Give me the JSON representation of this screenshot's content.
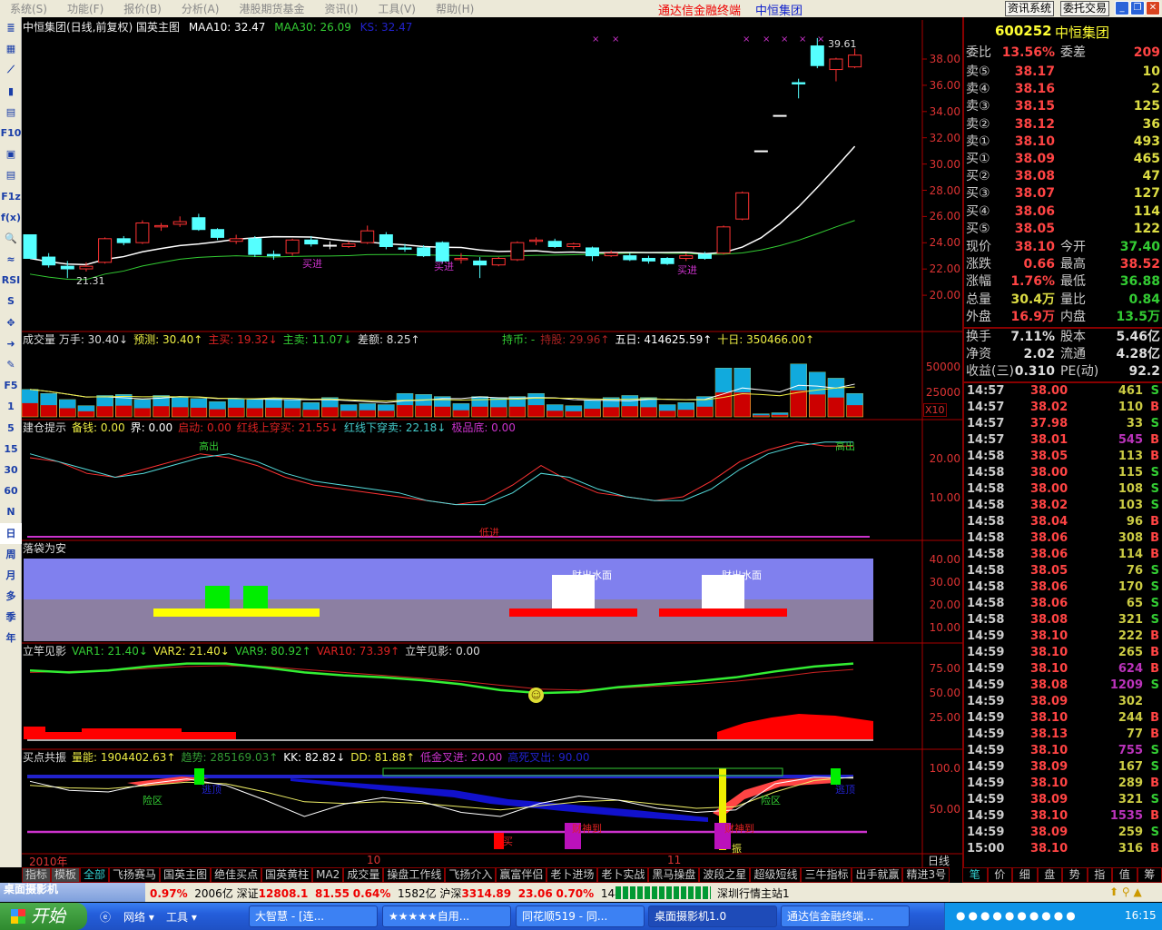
{
  "menu": [
    "系统(S)",
    "功能(F)",
    "报价(B)",
    "分析(A)",
    "港股期货基金",
    "资讯(I)",
    "工具(V)",
    "帮助(H)"
  ],
  "app_title": "通达信金融终端",
  "app_stock": "中恒集团",
  "top_buttons": {
    "news": "资讯系统",
    "trade": "委托交易"
  },
  "left_toolbar": [
    "≣",
    "▦",
    "⟋",
    "▮",
    "▤",
    "F10",
    "▣",
    "▤",
    "F1z",
    "f(x)",
    "🔍",
    "≈",
    "RSI",
    "S",
    "✥",
    "➜",
    "✎",
    "F5",
    "1",
    "5",
    "15",
    "30",
    "60",
    "N",
    "日",
    "周",
    "月",
    "多",
    "季",
    "年"
  ],
  "main_panel": {
    "title": "中恒集团(日线,前复权) 国英主图",
    "maa10": "MAA10: 32.47",
    "maa30": "MAA30: 26.09",
    "ks": "KS: 32.47",
    "high_label": "39.61",
    "low_label": "21.31",
    "buy_labels": [
      "买进",
      "买进",
      "买进"
    ],
    "axis": [
      "38.00",
      "36.00",
      "34.00",
      "32.00",
      "30.00",
      "28.00",
      "26.00",
      "24.00",
      "22.00",
      "20.00"
    ],
    "candles": [
      [
        24.6,
        24.6,
        22.8,
        22.8
      ],
      [
        22.9,
        23.2,
        22.1,
        22.3
      ],
      [
        22.2,
        22.6,
        21.3,
        22.0
      ],
      [
        22.0,
        22.5,
        21.8,
        22.2
      ],
      [
        22.5,
        24.4,
        22.4,
        24.3
      ],
      [
        24.3,
        24.5,
        23.8,
        24.0
      ],
      [
        24.0,
        25.7,
        23.9,
        25.5
      ],
      [
        25.2,
        25.5,
        24.9,
        25.3
      ],
      [
        25.4,
        26.0,
        25.2,
        25.6
      ],
      [
        25.9,
        26.2,
        24.9,
        25.0
      ],
      [
        25.0,
        25.1,
        24.2,
        24.4
      ],
      [
        24.1,
        24.6,
        23.9,
        24.3
      ],
      [
        24.3,
        24.5,
        22.9,
        23.1
      ],
      [
        23.1,
        23.4,
        22.7,
        23.0
      ],
      [
        23.2,
        24.3,
        23.0,
        24.2
      ],
      [
        24.2,
        24.5,
        23.7,
        23.9
      ],
      [
        23.8,
        24.1,
        23.5,
        23.8
      ],
      [
        23.7,
        24.1,
        23.6,
        23.9
      ],
      [
        24.0,
        25.3,
        23.9,
        24.9
      ],
      [
        24.6,
        24.8,
        23.5,
        23.7
      ],
      [
        23.6,
        23.9,
        23.3,
        23.5
      ],
      [
        23.6,
        23.8,
        22.9,
        23.0
      ],
      [
        24.0,
        24.1,
        22.4,
        22.6
      ],
      [
        22.7,
        23.2,
        22.4,
        22.8
      ],
      [
        22.6,
        22.9,
        21.3,
        22.3
      ],
      [
        22.3,
        22.9,
        22.2,
        22.8
      ],
      [
        22.7,
        24.1,
        22.6,
        24.0
      ],
      [
        24.1,
        24.4,
        23.8,
        24.2
      ],
      [
        24.1,
        24.3,
        23.6,
        23.7
      ],
      [
        23.7,
        24.0,
        23.5,
        23.9
      ],
      [
        23.6,
        23.7,
        22.6,
        23.0
      ],
      [
        23.0,
        23.4,
        22.9,
        23.2
      ],
      [
        23.0,
        23.2,
        22.6,
        22.7
      ],
      [
        22.8,
        23.0,
        22.4,
        22.6
      ],
      [
        22.8,
        22.9,
        22.3,
        22.4
      ],
      [
        22.8,
        23.2,
        22.6,
        23.0
      ],
      [
        23.1,
        23.3,
        22.7,
        22.8
      ],
      [
        23.2,
        25.3,
        23.1,
        25.2
      ],
      [
        25.8,
        27.9,
        25.7,
        27.8
      ],
      [
        31.0,
        31.0,
        31.0,
        31.0
      ],
      [
        33.7,
        33.7,
        33.7,
        33.7
      ],
      [
        36.2,
        36.5,
        35.0,
        36.1
      ],
      [
        39.0,
        39.6,
        37.3,
        37.5
      ],
      [
        37.2,
        38.1,
        36.3,
        38.0
      ],
      [
        37.4,
        38.8,
        37.3,
        38.3
      ]
    ]
  },
  "volume_panel": {
    "labels": [
      {
        "t": "成交量  万手: 30.40↓",
        "c": "#ddd"
      },
      {
        "t": "预测: 30.40↑",
        "c": "#ee4"
      },
      {
        "t": "主买: 19.32↓",
        "c": "#d22"
      },
      {
        "t": "主卖: 11.07↓",
        "c": "#3c3"
      },
      {
        "t": "差额: 8.25↑",
        "c": "#ddd"
      }
    ],
    "labels2": [
      {
        "t": "持币: -",
        "c": "#3c3"
      },
      {
        "t": "持股: 29.96↑",
        "c": "#a22"
      },
      {
        "t": "五日: 414625.59↑",
        "c": "#fff"
      },
      {
        "t": "十日: 350466.00↑",
        "c": "#ee4"
      }
    ],
    "axis": [
      "50000",
      "25000"
    ],
    "unit": "X10",
    "values": [
      27,
      23,
      17,
      11,
      21,
      22,
      17,
      21,
      19,
      18,
      15,
      18,
      17,
      18,
      17,
      14,
      19,
      12,
      13,
      12,
      23,
      22,
      20,
      13,
      20,
      19,
      20,
      23,
      12,
      11,
      16,
      19,
      21,
      19,
      12,
      14,
      20,
      48,
      48,
      3,
      4,
      52,
      44,
      38,
      23
    ]
  },
  "build_panel": {
    "labels": [
      {
        "t": "建仓提示",
        "c": "#ddd"
      },
      {
        "t": "备钱: 0.00",
        "c": "#ee4"
      },
      {
        "t": "界: 0.00",
        "c": "#fff"
      },
      {
        "t": "启动: 0.00",
        "c": "#d22"
      },
      {
        "t": "红线上穿买: 21.55↓",
        "c": "#d22"
      },
      {
        "t": "红线下穿卖: 22.18↓",
        "c": "#4cc"
      },
      {
        "t": "极品底: 0.00",
        "c": "#c3c"
      }
    ],
    "axis": [
      "20.00",
      "10.00"
    ],
    "high": "高出",
    "low": "低进",
    "red": [
      20,
      19,
      16,
      15,
      17,
      19,
      21,
      20,
      18,
      15,
      13,
      12,
      11,
      10,
      9,
      8,
      9,
      13,
      18,
      14,
      11,
      10,
      9,
      10,
      14,
      19,
      22,
      24,
      23,
      23
    ],
    "cyan": [
      21,
      19,
      17,
      15,
      16,
      18,
      20,
      21,
      19,
      16,
      14,
      13,
      12,
      11,
      9,
      8,
      8,
      11,
      16,
      15,
      12,
      10,
      9,
      9,
      12,
      17,
      21,
      23,
      24,
      24
    ]
  },
  "pocket_panel": {
    "title": "落袋为安",
    "tags": [
      "财出水面",
      "财出水面"
    ],
    "axis": [
      "40.00",
      "30.00",
      "20.00",
      "10.00"
    ]
  },
  "pole_panel": {
    "labels": [
      {
        "t": "立竿见影",
        "c": "#ddd"
      },
      {
        "t": "VAR1: 21.40↓",
        "c": "#3c3"
      },
      {
        "t": "VAR2: 21.40↓",
        "c": "#ee4"
      },
      {
        "t": "VAR9: 80.92↑",
        "c": "#3c3"
      },
      {
        "t": "VAR10: 73.39↑",
        "c": "#d22"
      },
      {
        "t": "立竿见影: 0.00",
        "c": "#ddd"
      }
    ],
    "axis": [
      "75.00",
      "50.00",
      "25.00"
    ],
    "green": [
      72,
      70,
      72,
      76,
      79,
      79,
      75,
      70,
      67,
      65,
      62,
      58,
      52,
      49,
      50,
      55,
      58,
      61,
      65,
      71,
      76,
      79
    ],
    "red": [
      70,
      71,
      72,
      74,
      76,
      77,
      76,
      73,
      70,
      67,
      64,
      61,
      57,
      53,
      52,
      54,
      56,
      58,
      61,
      65,
      70,
      73
    ]
  },
  "resonance_panel": {
    "labels": [
      {
        "t": "买点共振",
        "c": "#ddd"
      },
      {
        "t": "量能: 1904402.63↑",
        "c": "#ee4"
      },
      {
        "t": "趋势: 285169.03↑",
        "c": "#393"
      },
      {
        "t": "KK: 82.82↓",
        "c": "#fff"
      },
      {
        "t": "DD: 81.88↑",
        "c": "#ee4"
      },
      {
        "t": "低金叉进: 20.00",
        "c": "#c3c"
      },
      {
        "t": "高死叉出: 90.00",
        "c": "#22c"
      }
    ],
    "axis": [
      "100.0",
      "50.00"
    ],
    "zone_labels": [
      "险区",
      "逃顶",
      "险区",
      "逃顶"
    ],
    "god_labels": [
      "财神到",
      "财神到"
    ],
    "misc": [
      "买",
      "振"
    ],
    "white": [
      83,
      72,
      70,
      80,
      86,
      78,
      60,
      40,
      55,
      63,
      58,
      45,
      40,
      56,
      65,
      60,
      50,
      45,
      48,
      80,
      88,
      87
    ],
    "yellow": [
      78,
      75,
      74,
      78,
      82,
      80,
      70,
      58,
      56,
      58,
      56,
      52,
      48,
      53,
      58,
      60,
      55,
      50,
      52,
      70,
      84,
      88
    ]
  },
  "date_axis": {
    "labels": [
      "2010年",
      "10",
      "11"
    ],
    "period": "日线"
  },
  "right_panel": {
    "code": "600252",
    "name": "中恒集团",
    "ratio": {
      "label": "委比",
      "value": "13.56%",
      "label2": "委差",
      "value2": "209"
    },
    "sells": [
      {
        "l": "卖⑤",
        "p": "38.17",
        "v": "10"
      },
      {
        "l": "卖④",
        "p": "38.16",
        "v": "2"
      },
      {
        "l": "卖③",
        "p": "38.15",
        "v": "125"
      },
      {
        "l": "卖②",
        "p": "38.12",
        "v": "36"
      },
      {
        "l": "卖①",
        "p": "38.10",
        "v": "493"
      }
    ],
    "buys": [
      {
        "l": "买①",
        "p": "38.09",
        "v": "465"
      },
      {
        "l": "买②",
        "p": "38.08",
        "v": "47"
      },
      {
        "l": "买③",
        "p": "38.07",
        "v": "127"
      },
      {
        "l": "买④",
        "p": "38.06",
        "v": "114"
      },
      {
        "l": "买⑤",
        "p": "38.05",
        "v": "122"
      }
    ],
    "quote": [
      {
        "l": "现价",
        "v": "38.10",
        "c": "#f44",
        "l2": "今开",
        "v2": "37.40",
        "c2": "#3c3"
      },
      {
        "l": "涨跌",
        "v": "0.66",
        "c": "#f44",
        "l2": "最高",
        "v2": "38.52",
        "c2": "#f44"
      },
      {
        "l": "涨幅",
        "v": "1.76%",
        "c": "#f44",
        "l2": "最低",
        "v2": "36.88",
        "c2": "#3c3"
      },
      {
        "l": "总量",
        "v": "30.4万",
        "c": "#dd4",
        "l2": "量比",
        "v2": "0.84",
        "c2": "#3c3"
      },
      {
        "l": "外盘",
        "v": "16.9万",
        "c": "#f44",
        "l2": "内盘",
        "v2": "13.5万",
        "c2": "#3c3"
      }
    ],
    "fund": [
      {
        "l": "换手",
        "v": "7.11%",
        "l2": "股本",
        "v2": "5.46亿"
      },
      {
        "l": "净资",
        "v": "2.02",
        "l2": "流通",
        "v2": "4.28亿"
      },
      {
        "l": "收益(三)",
        "v": "0.310",
        "l2": "PE(动)",
        "v2": "92.2"
      }
    ],
    "ticks": [
      [
        "14:57",
        "38.00",
        "461",
        "S"
      ],
      [
        "14:57",
        "38.02",
        "110",
        "B"
      ],
      [
        "14:57",
        "37.98",
        "33",
        "S"
      ],
      [
        "14:57",
        "38.01",
        "545",
        "B"
      ],
      [
        "14:58",
        "38.05",
        "113",
        "B"
      ],
      [
        "14:58",
        "38.00",
        "115",
        "S"
      ],
      [
        "14:58",
        "38.00",
        "108",
        "S"
      ],
      [
        "14:58",
        "38.02",
        "103",
        "S"
      ],
      [
        "14:58",
        "38.04",
        "96",
        "B"
      ],
      [
        "14:58",
        "38.06",
        "308",
        "B"
      ],
      [
        "14:58",
        "38.06",
        "114",
        "B"
      ],
      [
        "14:58",
        "38.05",
        "76",
        "S"
      ],
      [
        "14:58",
        "38.06",
        "170",
        "S"
      ],
      [
        "14:58",
        "38.06",
        "65",
        "S"
      ],
      [
        "14:58",
        "38.08",
        "321",
        "S"
      ],
      [
        "14:59",
        "38.10",
        "222",
        "B"
      ],
      [
        "14:59",
        "38.10",
        "265",
        "B"
      ],
      [
        "14:59",
        "38.10",
        "624",
        "B"
      ],
      [
        "14:59",
        "38.08",
        "1209",
        "S"
      ],
      [
        "14:59",
        "38.09",
        "302",
        ""
      ],
      [
        "14:59",
        "38.10",
        "244",
        "B"
      ],
      [
        "14:59",
        "38.13",
        "77",
        "B"
      ],
      [
        "14:59",
        "38.10",
        "755",
        "S"
      ],
      [
        "14:59",
        "38.09",
        "167",
        "S"
      ],
      [
        "14:59",
        "38.10",
        "289",
        "B"
      ],
      [
        "14:59",
        "38.09",
        "321",
        "S"
      ],
      [
        "14:59",
        "38.10",
        "1535",
        "B"
      ],
      [
        "14:59",
        "38.09",
        "259",
        "S"
      ],
      [
        "15:00",
        "38.10",
        "316",
        "B"
      ]
    ]
  },
  "tabs": [
    "指标",
    "模板",
    "全部",
    "飞扬赛马",
    "国英主图",
    "绝佳买点",
    "国英黄柱",
    "MA2",
    "成交量",
    "操盘工作线",
    "飞扬介入",
    "赢富伴侣",
    "老卜进场",
    "老卜实战",
    "黑马操盘",
    "波段之星",
    "超级短线",
    "三牛指标",
    "出手就赢",
    "精进3号"
  ],
  "right_tabs": [
    "笔",
    "价",
    "细",
    "盘",
    "势",
    "指",
    "值",
    "筹"
  ],
  "status": {
    "app": "桌面摄影机",
    "sh_pct": "0.97%",
    "sh_amt": "2006亿",
    "sz_label": "深证",
    "sz": "12808.1",
    "sz_chg": "81.55",
    "sz_pct": "0.64%",
    "sz_amt": "1582亿",
    "hs_label": "沪深",
    "hs": "3314.89",
    "hs_chg": "23.06",
    "hs_pct": "0.70%",
    "hs_amt": "1445亿",
    "server": "深圳行情主站1"
  },
  "taskbar": {
    "start": "开始",
    "quick": [
      "网络 ▾",
      "工具 ▾"
    ],
    "tasks": [
      "大智慧 - [连...",
      "★★★★★自用...",
      "同花顺519 - 同...",
      "桌面摄影机1.0",
      "通达信金融终端..."
    ],
    "clock": "16:15"
  }
}
